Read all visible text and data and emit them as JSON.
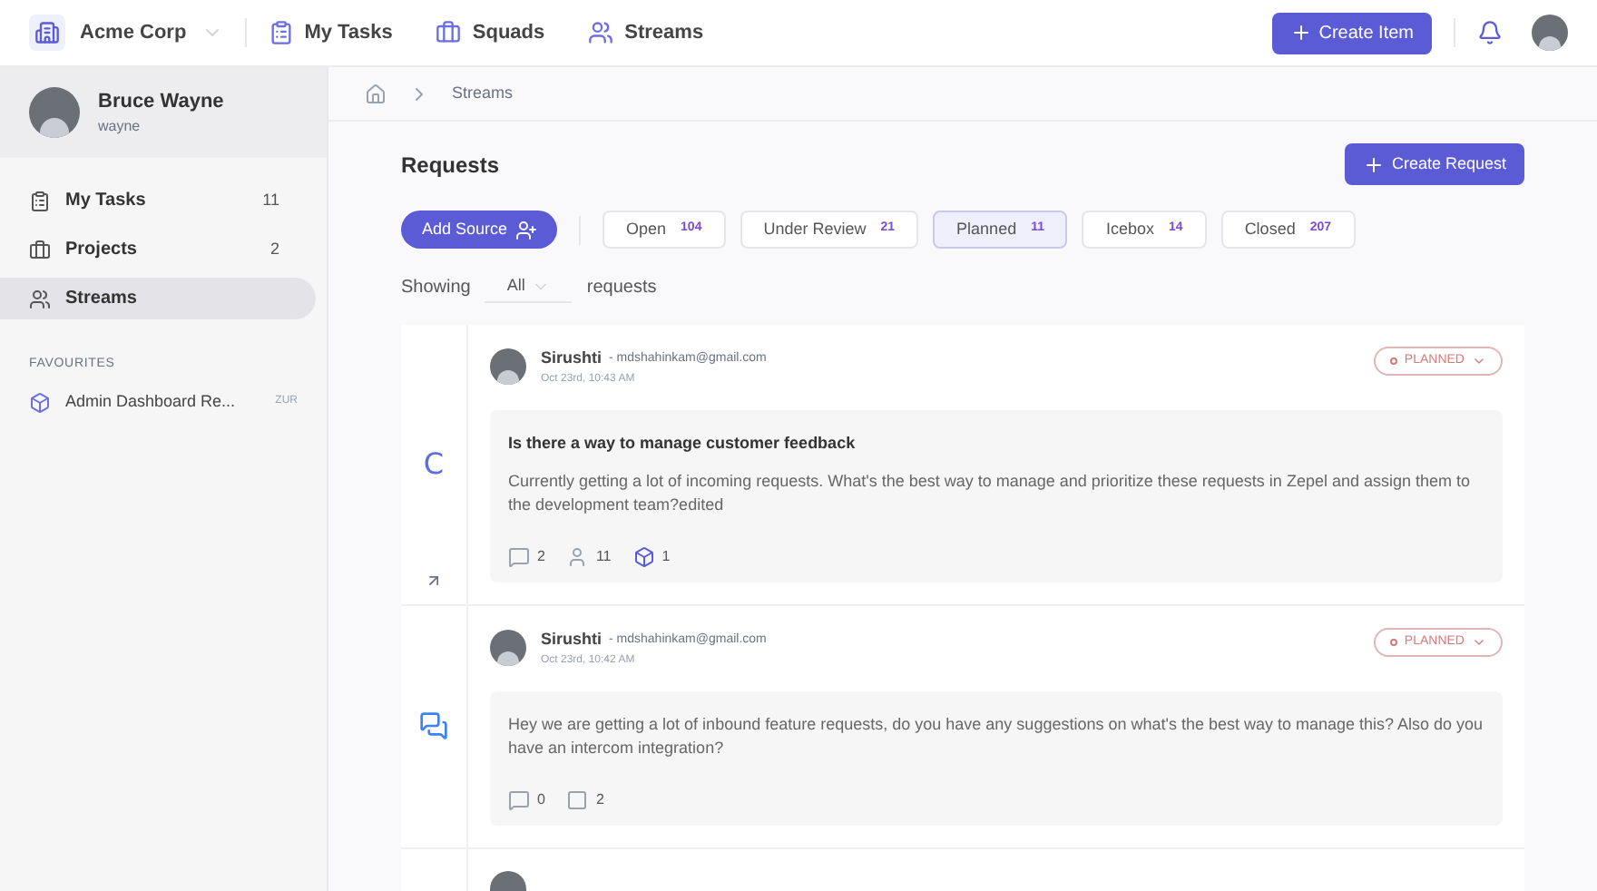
{
  "topbar": {
    "workspace": "Acme Corp",
    "nav": [
      {
        "kind": "tasks",
        "label": "My Tasks"
      },
      {
        "kind": "squads",
        "label": "Squads"
      },
      {
        "kind": "streams",
        "label": "Streams"
      }
    ],
    "create_button": "Create Item"
  },
  "sidebar": {
    "user": {
      "name": "Bruce Wayne",
      "handle": "wayne"
    },
    "items": [
      {
        "kind": "tasks",
        "label": "My Tasks",
        "count": "11",
        "selected": false
      },
      {
        "kind": "projects",
        "label": "Projects",
        "count": "2",
        "selected": false
      },
      {
        "kind": "streams",
        "label": "Streams",
        "selected": true
      }
    ],
    "favourites_heading": "FAVOURITES",
    "favourites": [
      {
        "label": "Admin Dashboard Re...",
        "tag": "ZUR"
      }
    ]
  },
  "breadcrumb": [
    "Streams"
  ],
  "page": {
    "title": "Requests",
    "create_button": "Create Request",
    "add_source": "Add Source",
    "filters": [
      {
        "label": "Open",
        "count": "104",
        "selected": false
      },
      {
        "label": "Under Review",
        "count": "21",
        "selected": false
      },
      {
        "label": "Planned",
        "count": "11",
        "selected": true
      },
      {
        "label": "Icebox",
        "count": "14",
        "selected": false
      },
      {
        "label": "Closed",
        "count": "207",
        "selected": false
      }
    ],
    "showing": {
      "prefix": "Showing",
      "value": "All",
      "suffix": "requests"
    }
  },
  "requests": [
    {
      "source": {
        "kind": "letter",
        "mark": "C"
      },
      "link": true,
      "author": "Sirushti",
      "email": "- mdshahinkam@gmail.com",
      "time": "Oct 23rd, 10:43 AM",
      "status": "PLANNED",
      "title": "Is there a way to manage customer feedback",
      "body": "Currently getting a lot of incoming requests. What's the best way to manage and prioritize these requests in Zepel and assign them to the development team?edited",
      "stats": [
        {
          "kind": "comments",
          "count": "2"
        },
        {
          "kind": "votes",
          "count": "11"
        },
        {
          "kind": "items",
          "count": "1"
        }
      ]
    },
    {
      "source": {
        "kind": "chat"
      },
      "link": false,
      "author": "Sirushti",
      "email": "- mdshahinkam@gmail.com",
      "time": "Oct 23rd, 10:42 AM",
      "status": "PLANNED",
      "body": "Hey we are getting a lot of inbound feature requests, do you have any suggestions on what's the best way to manage this? Also do you have an intercom integration?",
      "stats": [
        {
          "kind": "comments",
          "count": "0"
        },
        {
          "kind": "notes",
          "count": "2"
        }
      ]
    },
    {
      "source": {
        "kind": "none"
      }
    }
  ]
}
